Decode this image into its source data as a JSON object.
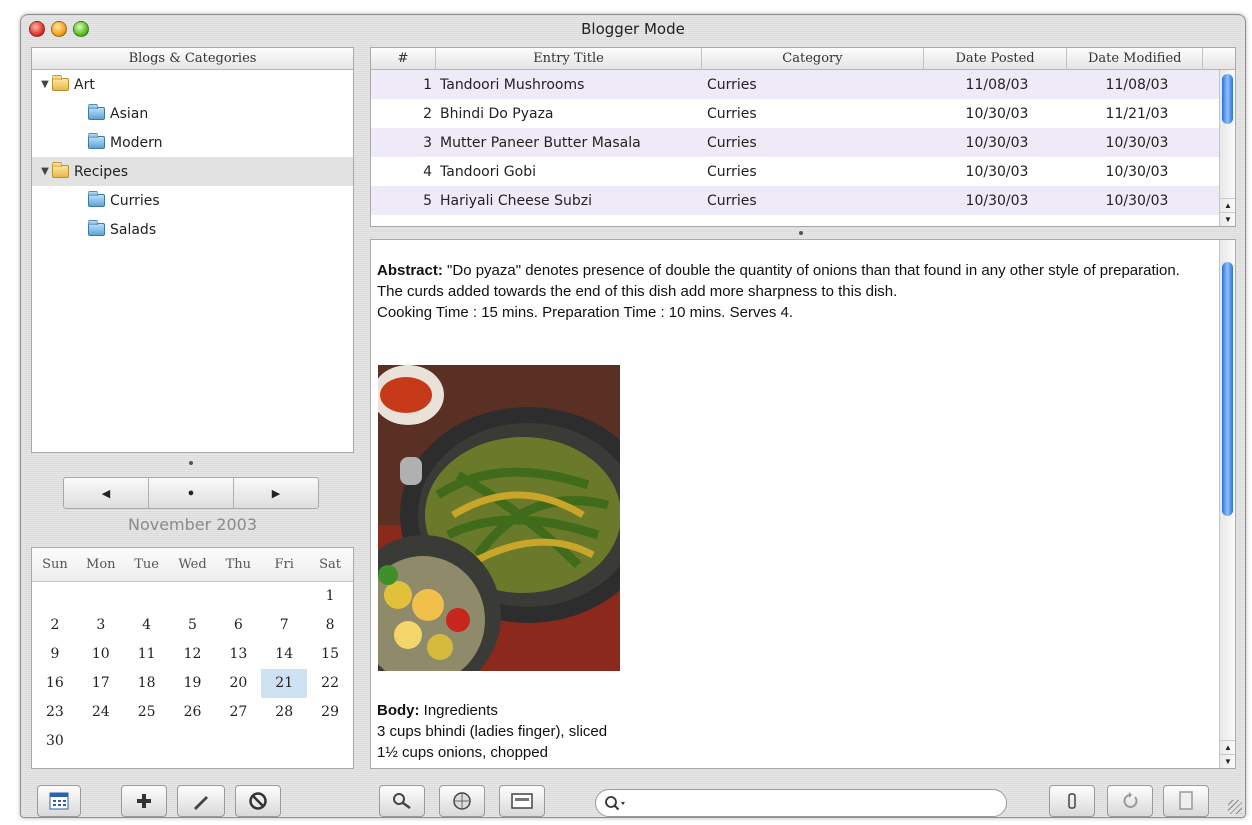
{
  "window": {
    "title": "Blogger Mode"
  },
  "tree": {
    "header": "Blogs & Categories",
    "items": [
      {
        "label": "Art",
        "level": 0,
        "expanded": true,
        "folder": "yellow"
      },
      {
        "label": "Asian",
        "level": 1,
        "folder": "blue"
      },
      {
        "label": "Modern",
        "level": 1,
        "folder": "blue"
      },
      {
        "label": "Recipes",
        "level": 0,
        "expanded": true,
        "folder": "yellow",
        "selected": true
      },
      {
        "label": "Curries",
        "level": 1,
        "folder": "blue"
      },
      {
        "label": "Salads",
        "level": 1,
        "folder": "blue"
      }
    ]
  },
  "nav": {
    "prev": "◀",
    "today": "●",
    "next": "▶"
  },
  "calendar": {
    "month_label": "November 2003",
    "weekdays": [
      "Sun",
      "Mon",
      "Tue",
      "Wed",
      "Thu",
      "Fri",
      "Sat"
    ],
    "days": [
      "",
      "",
      "",
      "",
      "",
      "",
      "1",
      "2",
      "3",
      "4",
      "5",
      "6",
      "7",
      "8",
      "9",
      "10",
      "11",
      "12",
      "13",
      "14",
      "15",
      "16",
      "17",
      "18",
      "19",
      "20",
      "21",
      "22",
      "23",
      "24",
      "25",
      "26",
      "27",
      "28",
      "29",
      "30"
    ],
    "selected_day": "21"
  },
  "table": {
    "headers": [
      "#",
      "Entry Title",
      "Category",
      "Date Posted",
      "Date Modified"
    ],
    "rows": [
      {
        "num": "1",
        "title": "Tandoori Mushrooms",
        "category": "Curries",
        "posted": "11/08/03",
        "modified": "11/08/03"
      },
      {
        "num": "2",
        "title": "Bhindi Do Pyaza",
        "category": "Curries",
        "posted": "10/30/03",
        "modified": "11/21/03"
      },
      {
        "num": "3",
        "title": "Mutter Paneer Butter Masala",
        "category": "Curries",
        "posted": "10/30/03",
        "modified": "10/30/03"
      },
      {
        "num": "4",
        "title": "Tandoori Gobi",
        "category": "Curries",
        "posted": "10/30/03",
        "modified": "10/30/03"
      },
      {
        "num": "5",
        "title": "Hariyali Cheese Subzi",
        "category": "Curries",
        "posted": "10/30/03",
        "modified": "10/30/03"
      }
    ]
  },
  "entry": {
    "abstract_label": "Abstract:",
    "abstract_text": "\"Do pyaza\" denotes presence of double the quantity of onions than that found in any other style of preparation. The curds added towards the end of this dish add more sharpness to this dish.",
    "info_line": "Cooking Time : 15 mins. Preparation Time : 10 mins. Serves 4.",
    "body_label": "Body:",
    "body_title": "Ingredients",
    "body_lines": [
      "3 cups bhindi (ladies finger), sliced",
      "1½ cups onions, chopped"
    ]
  },
  "search": {
    "placeholder": ""
  },
  "toolbar": {
    "icons": [
      "calendar-icon",
      "plus-icon",
      "pencil-icon",
      "prohibit-icon",
      "magnifier-icon",
      "globe-icon",
      "card-icon",
      "info-icon",
      "refresh-icon",
      "page-icon"
    ]
  },
  "colors": {
    "accent": "#2a72d8",
    "row_alt": "#efeaf7",
    "selected_day": "#cfe2f4"
  }
}
